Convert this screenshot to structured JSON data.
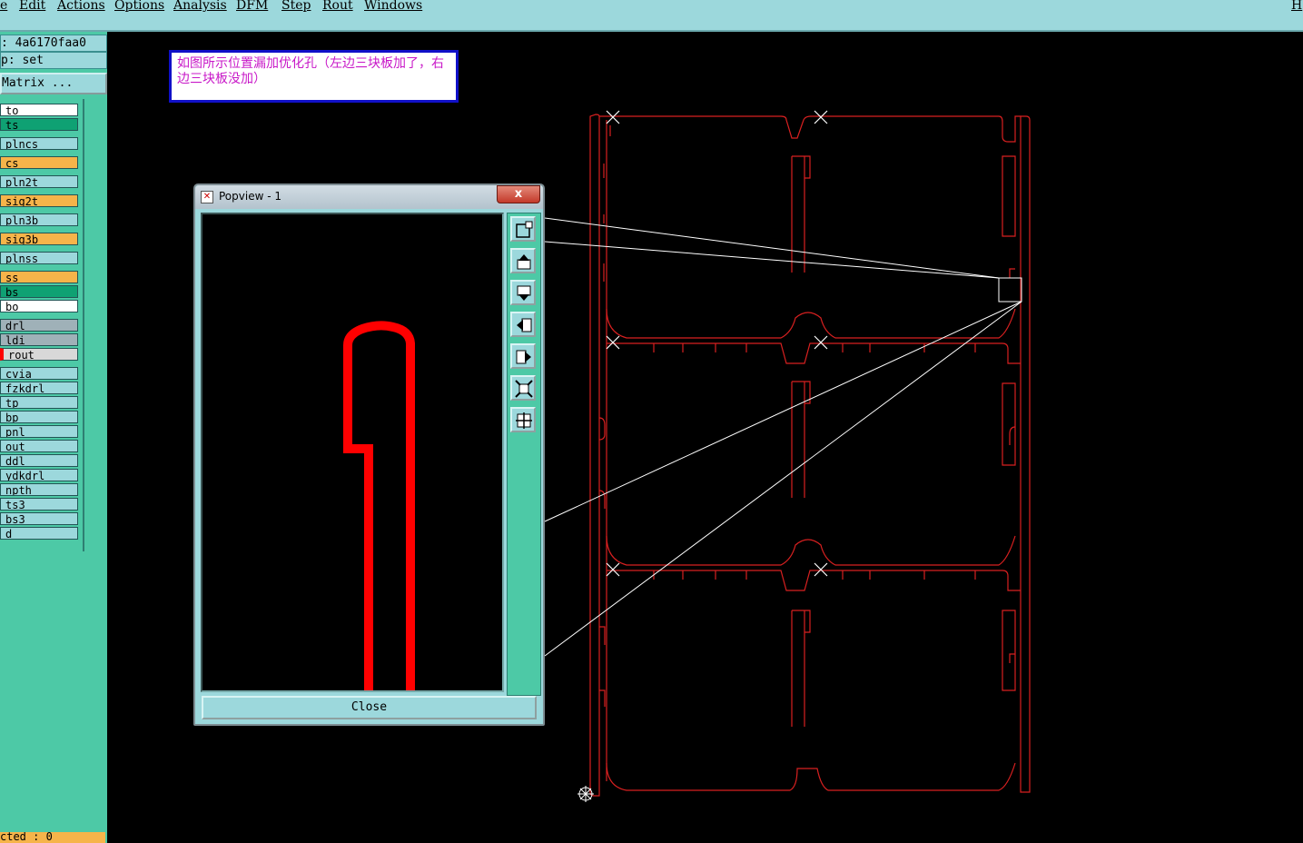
{
  "menubar": {
    "items": [
      "e",
      "Edit",
      "Actions",
      "Options",
      "Analysis",
      "DFM",
      "Step",
      "Rout",
      "Windows",
      "H"
    ]
  },
  "left_panel": {
    "info_lines": [
      ": 4a6170faa0",
      "p: set"
    ],
    "matrix_button": "Matrix ...",
    "status": "cted : 0",
    "layers": [
      {
        "name": "to",
        "color": "#ffffff"
      },
      {
        "name": "ts",
        "color": "#0fa173"
      },
      {
        "name": "plncs",
        "color": "#9cd8dc"
      },
      {
        "name": "cs",
        "color": "#f6b44a"
      },
      {
        "name": "pln2t",
        "color": "#9cd8dc"
      },
      {
        "name": "sig2t",
        "color": "#f6b44a"
      },
      {
        "name": "pln3b",
        "color": "#9cd8dc"
      },
      {
        "name": "sig3b",
        "color": "#f6b44a"
      },
      {
        "name": "plnss",
        "color": "#9cd8dc"
      },
      {
        "name": "ss",
        "color": "#f6b44a"
      },
      {
        "name": "bs",
        "color": "#0fa173"
      },
      {
        "name": "bo",
        "color": "#ffffff"
      },
      {
        "name": "drl",
        "color": "#9fb1b8"
      },
      {
        "name": "ldi",
        "color": "#9fb1b8"
      },
      {
        "name": "rout",
        "color": "#d8d8d8"
      },
      {
        "name": "cvia",
        "color": "#9cd8dc"
      },
      {
        "name": "fzkdrl",
        "color": "#9cd8dc"
      },
      {
        "name": "tp",
        "color": "#9cd8dc"
      },
      {
        "name": "bp",
        "color": "#9cd8dc"
      },
      {
        "name": "pnl",
        "color": "#9cd8dc"
      },
      {
        "name": "out",
        "color": "#9cd8dc"
      },
      {
        "name": "ddl",
        "color": "#9cd8dc"
      },
      {
        "name": "ydkdrl",
        "color": "#9cd8dc"
      },
      {
        "name": "npth",
        "color": "#9cd8dc"
      },
      {
        "name": "ts3",
        "color": "#9cd8dc"
      },
      {
        "name": "bs3",
        "color": "#9cd8dc"
      },
      {
        "name": "d",
        "color": "#9cd8dc"
      }
    ]
  },
  "note": {
    "text": "如图所示位置漏加优化孔（左边三块板加了，右边三块板没加）"
  },
  "popview": {
    "title": "Popview - 1",
    "close_x": "x",
    "close_button": "Close",
    "tools": [
      "zoom-window-icon",
      "pan-up-icon",
      "pan-down-icon",
      "pan-left-icon",
      "pan-right-icon",
      "zoom-in-icon",
      "zoom-out-icon"
    ]
  },
  "colors": {
    "menubar_bg": "#9cd8dc",
    "panel_bg": "#4dc9a6",
    "rout_red": "#ff0000",
    "outline_red": "#d82020",
    "note_text": "#c818c8",
    "note_border": "#1010c8"
  }
}
